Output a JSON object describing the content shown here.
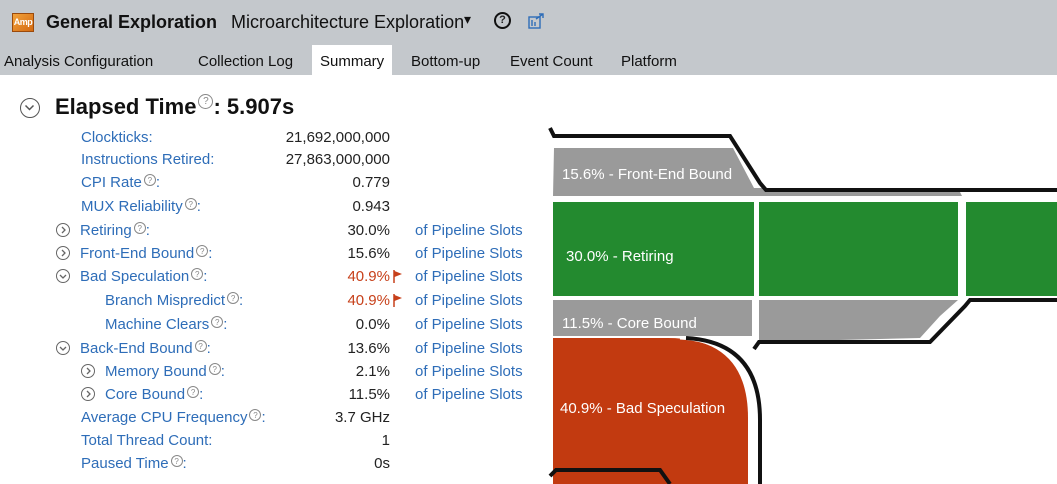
{
  "header": {
    "logo_text": "Amp",
    "title": "General Exploration",
    "subtitle": "Microarchitecture Exploration",
    "caret": "▾",
    "help": "?"
  },
  "tabs": [
    {
      "label": "Analysis Configuration"
    },
    {
      "label": "Collection Log"
    },
    {
      "label": "Summary",
      "active": true
    },
    {
      "label": "Bottom-up"
    },
    {
      "label": "Event Count"
    },
    {
      "label": "Platform"
    }
  ],
  "summary": {
    "elapsed_label": "Elapsed Time",
    "elapsed_sep": ":",
    "elapsed_value": "5.907s",
    "help_glyph": "?",
    "unit_text": "of Pipeline Slots",
    "metrics": [
      {
        "label": "Clockticks:",
        "value": "21,692,000,000"
      },
      {
        "label": "Instructions Retired:",
        "value": "27,863,000,000"
      },
      {
        "label": "CPI Rate",
        "suffix": ":",
        "value": "0.779"
      },
      {
        "label": "MUX Reliability",
        "suffix": ":",
        "value": "0.943"
      },
      {
        "label": "Retiring",
        "suffix": ":",
        "value": "30.0%",
        "unit": "of Pipeline Slots"
      },
      {
        "label": "Front-End Bound",
        "suffix": ":",
        "value": "15.6%",
        "unit": "of Pipeline Slots"
      },
      {
        "label": "Bad Speculation",
        "suffix": ":",
        "value": "40.9%",
        "unit": "of Pipeline Slots",
        "flagged": true
      },
      {
        "label": "Branch Mispredict",
        "suffix": ":",
        "value": "40.9%",
        "unit": "of Pipeline Slots",
        "flagged": true
      },
      {
        "label": "Machine Clears",
        "suffix": ":",
        "value": "0.0%",
        "unit": "of Pipeline Slots"
      },
      {
        "label": "Back-End Bound",
        "suffix": ":",
        "value": "13.6%",
        "unit": "of Pipeline Slots"
      },
      {
        "label": "Memory Bound",
        "suffix": ":",
        "value": "2.1%",
        "unit": "of Pipeline Slots"
      },
      {
        "label": "Core Bound",
        "suffix": ":",
        "value": "11.5%",
        "unit": "of Pipeline Slots"
      },
      {
        "label": "Average CPU Frequency",
        "suffix": ":",
        "value": "3.7 GHz"
      },
      {
        "label": "Total Thread Count:",
        "value": "1"
      },
      {
        "label": "Paused Time",
        "suffix": ":",
        "value": "0s"
      }
    ]
  },
  "pipeline_diagram": {
    "segments": [
      {
        "label": "15.6% - Front-End Bound",
        "color": "#9a9a9a"
      },
      {
        "label": "30.0% - Retiring",
        "color": "#238a2f"
      },
      {
        "label": "11.5% - Core Bound",
        "color": "#9a9a9a"
      },
      {
        "label": "40.9% - Bad Speculation",
        "color": "#c23a10"
      }
    ]
  },
  "colors": {
    "toolbar_bg": "#c4c8cc",
    "link_blue": "#2e6db8",
    "alert": "#c7401a"
  }
}
